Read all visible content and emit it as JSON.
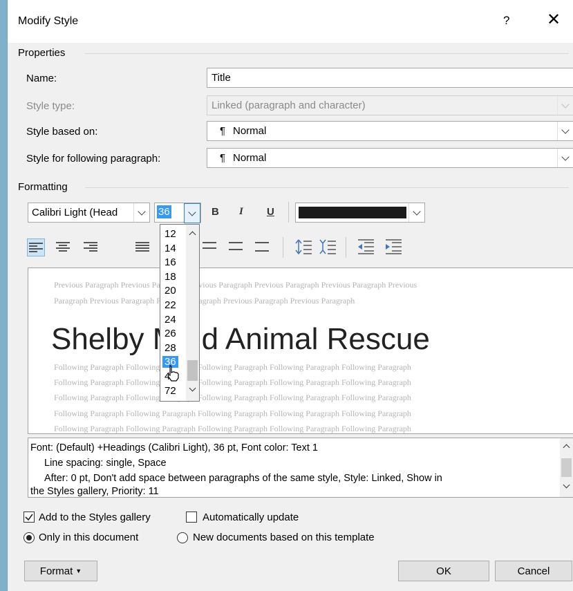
{
  "dialog": {
    "title": "Modify Style",
    "help": "?",
    "close": "✕"
  },
  "properties": {
    "heading": "Properties",
    "name_label": "Name:",
    "name_value": "Title",
    "style_type_label": "Style type:",
    "style_type_value": "Linked (paragraph and character)",
    "based_on_label": "Style based on:",
    "based_on_value": "Normal",
    "following_label": "Style for following paragraph:",
    "following_value": "Normal",
    "pilcrow": "¶"
  },
  "formatting": {
    "heading": "Formatting",
    "font": "Calibri Light (Head",
    "size": "36",
    "bold": "B",
    "italic": "I",
    "underline": "U",
    "font_color": "#1a1a1a"
  },
  "size_list": {
    "options": [
      "12",
      "14",
      "16",
      "18",
      "20",
      "22",
      "24",
      "26",
      "28",
      "36",
      "48",
      "72"
    ],
    "selected": "36"
  },
  "preview": {
    "previous_line1": "Previous Paragraph Previous Paragraph Previous Paragraph Previous Paragraph Previous Paragraph Previous",
    "previous_line2": "Paragraph Previous Paragraph Previous Paragraph Previous Paragraph Previous Paragraph",
    "sample": "Shelby Mold Animal Rescue",
    "following_line": "Following Paragraph Following Paragraph Following Paragraph Following Paragraph Following Paragraph"
  },
  "description": {
    "line1": "Font: (Default) +Headings (Calibri Light), 36 pt, Font color: Text 1",
    "line2": "Line spacing:  single, Space",
    "line3": "After:  0 pt, Don't add space between paragraphs of the same style, Style: Linked, Show in",
    "line4": "the Styles gallery, Priority: 11"
  },
  "options": {
    "add_gallery": "Add to the Styles gallery",
    "add_gallery_checked": true,
    "auto_update": "Automatically update",
    "auto_update_checked": false,
    "only_doc": "Only in this document",
    "new_docs": "New documents based on this template"
  },
  "buttons": {
    "format": "Format",
    "ok": "OK",
    "cancel": "Cancel"
  }
}
